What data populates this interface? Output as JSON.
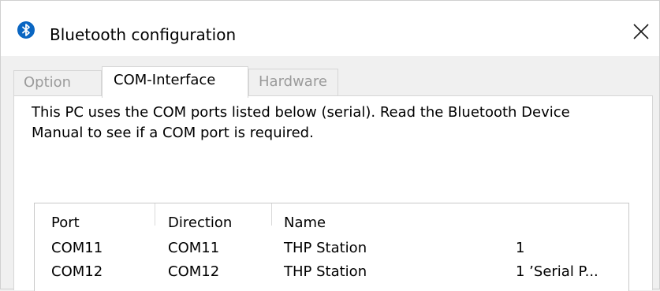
{
  "window": {
    "title": "Bluetooth configuration",
    "icon": "bluetooth-icon",
    "close_icon": "close-icon"
  },
  "tabs": [
    {
      "label": "Option",
      "state": "disabled"
    },
    {
      "label": "COM-Interface",
      "state": "selected"
    },
    {
      "label": "Hardware",
      "state": "disabled"
    }
  ],
  "panel": {
    "description": "This PC uses the COM ports listed below (serial). Read the Bluetooth Device Manual to see if a COM port is required."
  },
  "ports_table": {
    "columns": [
      "Port",
      "Direction",
      "Name"
    ],
    "rows": [
      {
        "port": "COM11",
        "direction": "COM11",
        "name": "THP Station",
        "extra": "1"
      },
      {
        "port": "COM12",
        "direction": "COM12",
        "name": "THP Station",
        "extra": "1 ’Serial P..."
      }
    ]
  },
  "colors": {
    "accent": "#0a66c2",
    "disabled_text": "#9b9b9b",
    "window_bg": "#f0f0f0"
  }
}
